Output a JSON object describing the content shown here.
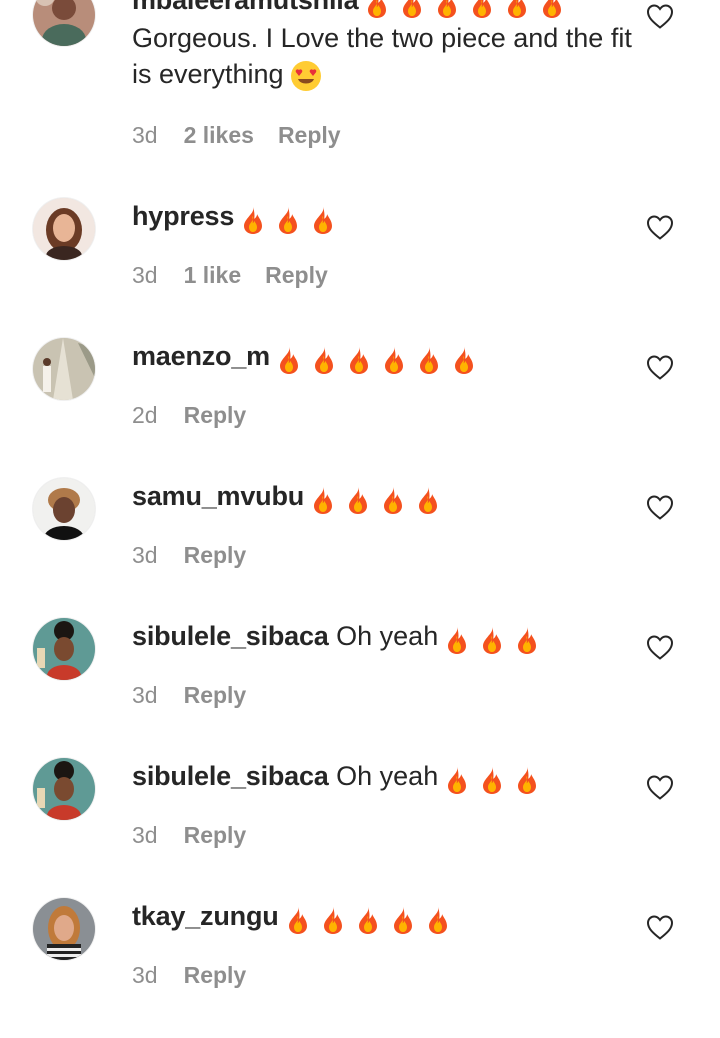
{
  "comments": [
    {
      "username": "mbaleeramutshila",
      "text": "Gorgeous. I Love the two piece and the fit is everything",
      "fire_count": 6,
      "trailing_emoji": "heart-eyes-emoji",
      "time": "3d",
      "likes": "2 likes",
      "reply": "Reply"
    },
    {
      "username": "hypress",
      "text": "",
      "fire_count": 3,
      "time": "3d",
      "likes": "1 like",
      "reply": "Reply"
    },
    {
      "username": "maenzo_m",
      "text": "",
      "fire_count": 6,
      "time": "2d",
      "likes": "",
      "reply": "Reply"
    },
    {
      "username": "samu_mvubu",
      "text": "",
      "fire_count": 4,
      "time": "3d",
      "likes": "",
      "reply": "Reply"
    },
    {
      "username": "sibulele_sibaca",
      "text": "Oh yeah",
      "fire_count": 3,
      "time": "3d",
      "likes": "",
      "reply": "Reply"
    },
    {
      "username": "sibulele_sibaca",
      "text": "Oh yeah",
      "fire_count": 3,
      "time": "3d",
      "likes": "",
      "reply": "Reply"
    },
    {
      "username": "tkay_zungu",
      "text": "",
      "fire_count": 5,
      "time": "3d",
      "likes": "",
      "reply": "Reply"
    }
  ],
  "icons": {
    "like": "heart-outline-icon",
    "reaction": "fire-emoji"
  },
  "colors": {
    "text_primary": "#262626",
    "text_secondary": "#8e8e8e",
    "background": "#ffffff"
  }
}
